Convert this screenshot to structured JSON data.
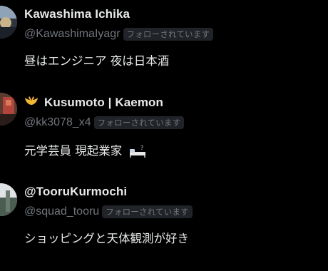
{
  "users": [
    {
      "display_name": "Kawashima Ichika",
      "handle": "@KawashimaIyagr",
      "follows_badge": "フォローされています",
      "bio": "昼はエンジニア 夜は日本酒"
    },
    {
      "name_emoji": "wings-icon",
      "display_name": "Kusumoto | Kaemon",
      "handle": "@kk3078_x4",
      "follows_badge": "フォローされています",
      "bio": "元学芸員 現起業家",
      "bio_emoji": "bed-icon"
    },
    {
      "display_name": "@TooruKurmochi",
      "handle": "@squad_tooru",
      "follows_badge": "フォローされています",
      "bio": "ショッピングと天体観測が好き"
    }
  ],
  "colors": {
    "background": "#000000",
    "primary_text": "#e7e9ea",
    "secondary_text": "#71767b",
    "badge_background": "#202327"
  }
}
